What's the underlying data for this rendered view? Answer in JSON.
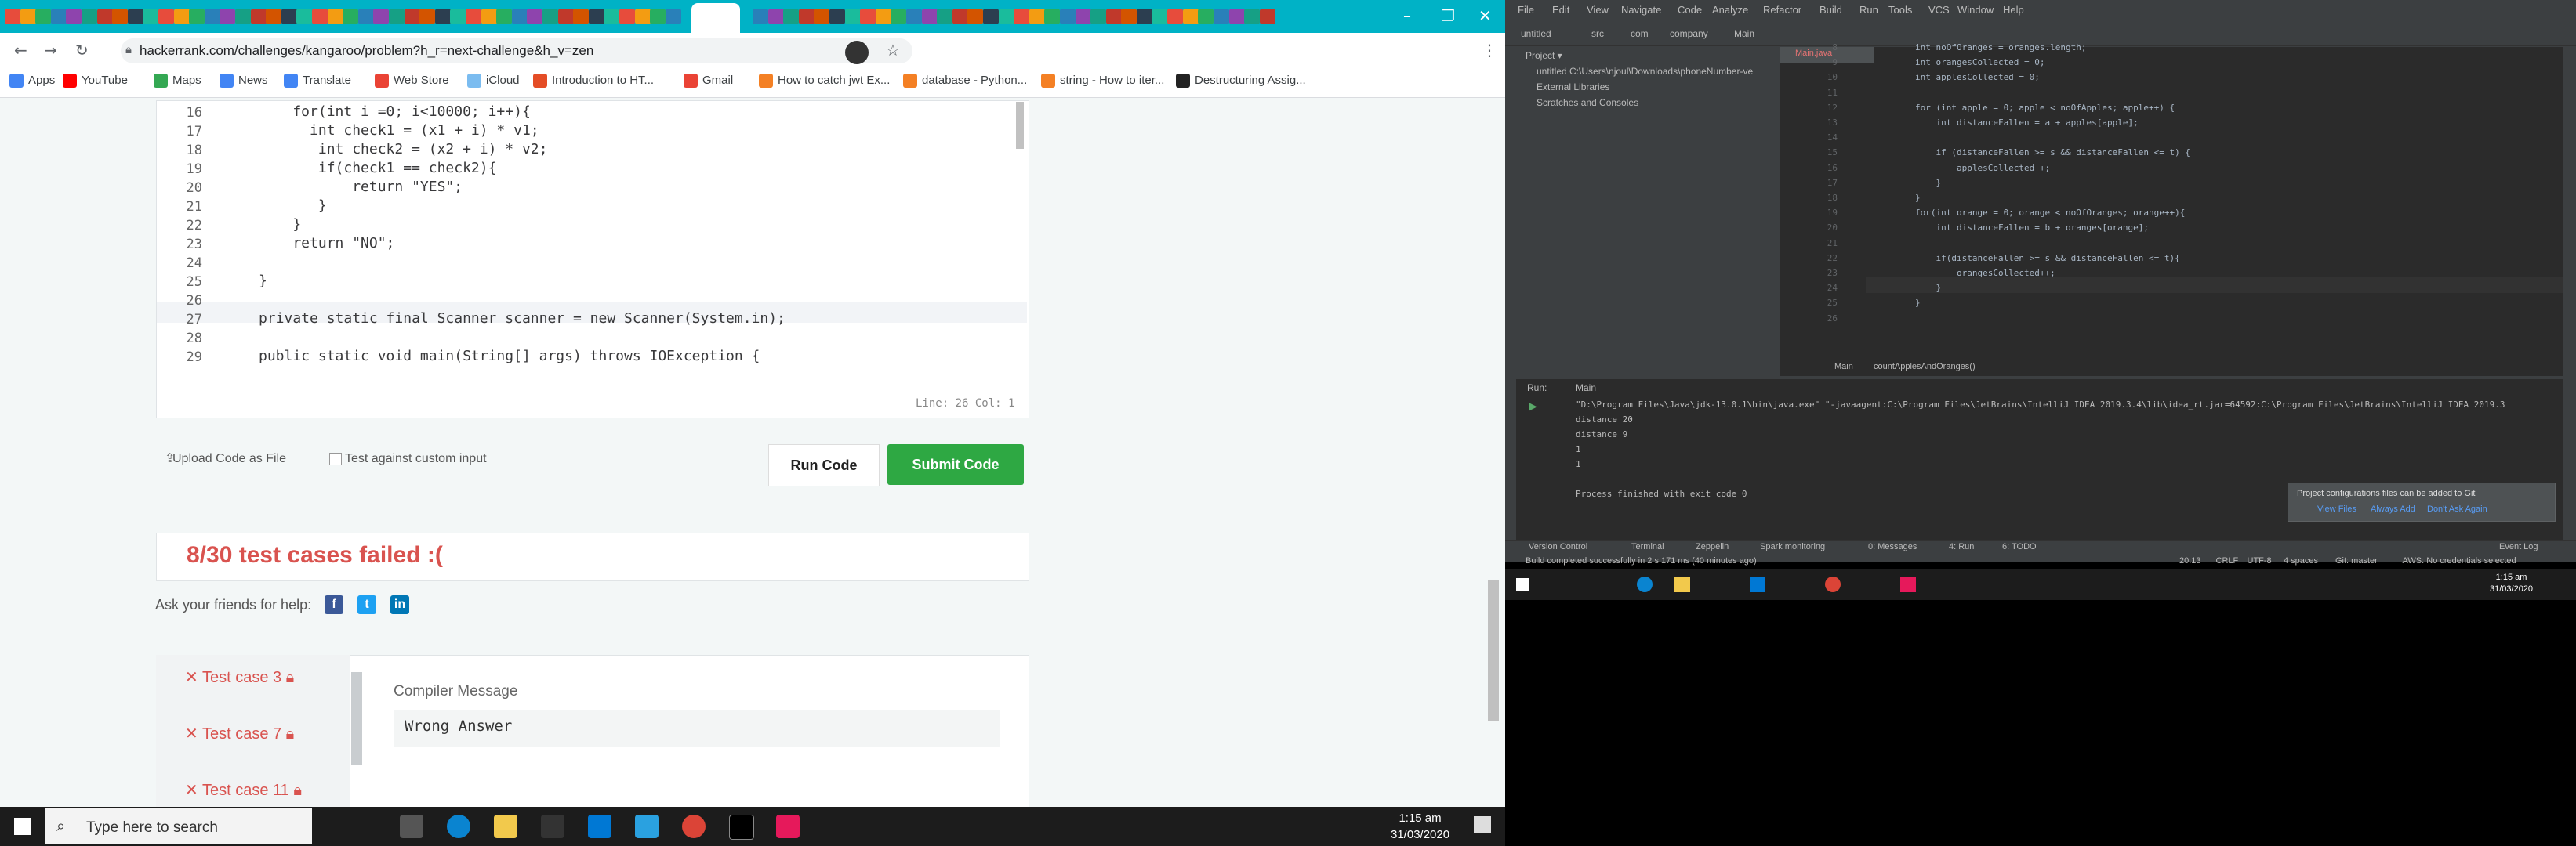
{
  "browser": {
    "url": "hackerrank.com/challenges/kangaroo/problem?h_r=next-challenge&h_v=zen",
    "bookmarks": [
      "Apps",
      "YouTube",
      "Maps",
      "News",
      "Translate",
      "Web Store",
      "iCloud",
      "Introduction to HT...",
      "Gmail",
      "How to catch jwt Ex...",
      "database - Python...",
      "string - How to iter...",
      "Destructuring Assig..."
    ]
  },
  "editor": {
    "line_numbers": [
      "16",
      "17",
      "18",
      "19",
      "20",
      "21",
      "22",
      "23",
      "24",
      "25",
      "26",
      "27",
      "28",
      "29"
    ],
    "lines": [
      "    for(int i =0; i<10000; i++){",
      "      int check1 = (x1 + i) * v1;",
      "       int check2 = (x2 + i) * v2;",
      "       if(check1 == check2){",
      "           return \"YES\";",
      "       }",
      "    }",
      "    return \"NO\";",
      "",
      "}",
      "",
      "private static final Scanner scanner = new Scanner(System.in);",
      "",
      "public static void main(String[] args) throws IOException {"
    ],
    "status": "Line: 26 Col: 1"
  },
  "actions": {
    "upload": "Upload Code as File",
    "custom_input": "Test against custom input",
    "run": "Run Code",
    "submit": "Submit Code"
  },
  "result": "8/30 test cases failed :(",
  "ask_friends": "Ask your friends for help:",
  "test_cases": [
    "Test case 3",
    "Test case 7",
    "Test case 11"
  ],
  "compiler": {
    "label": "Compiler Message",
    "value": "Wrong Answer"
  },
  "taskbar": {
    "search": "Type here to search",
    "time": "1:15 am",
    "date": "31/03/2020"
  },
  "ide": {
    "menu": [
      "File",
      "Edit",
      "View",
      "Navigate",
      "Code",
      "Analyze",
      "Refactor",
      "Build",
      "Run",
      "Tools",
      "VCS",
      "Window",
      "Help"
    ],
    "breadcrumbs": [
      "untitled",
      "src",
      "com",
      "company",
      "Main"
    ],
    "tab": "Main.java",
    "project_items": [
      "untitled C:\\Users\\njoul\\Downloads\\phoneNumber-ve",
      "External Libraries",
      "Scratches and Consoles"
    ],
    "line_numbers": [
      "",
      "",
      "",
      "",
      "",
      "",
      "",
      "",
      "",
      "",
      "",
      "",
      "",
      "",
      "",
      "",
      "",
      "",
      ""
    ],
    "code": [
      "        int noOfOranges = oranges.length;",
      "        int orangesCollected = 0;",
      "        int applesCollected = 0;",
      "",
      "        for (int apple = 0; apple < noOfApples; apple++) {",
      "            int distanceFallen = a + apples[apple];",
      "",
      "            if (distanceFallen >= s && distanceFallen <= t) {",
      "                applesCollected++;",
      "            }",
      "        }",
      "        for(int orange = 0; orange < noOfOranges; orange++){",
      "            int distanceFallen = b + oranges[orange];",
      "",
      "            if(distanceFallen >= s && distanceFallen <= t){",
      "                orangesCollected++;",
      "            }",
      "        }",
      ""
    ],
    "code_footer": [
      "Main",
      "countApplesAndOranges()"
    ],
    "run_tab": "Main",
    "console": [
      "\"D:\\Program Files\\Java\\jdk-13.0.1\\bin\\java.exe\" \"-javaagent:C:\\Program Files\\JetBrains\\IntelliJ IDEA 2019.3.4\\lib\\idea_rt.jar=64592:C:\\Program Files\\JetBrains\\IntelliJ IDEA 2019.3",
      "distance 20",
      "distance 9",
      "1",
      "1",
      "",
      "Process finished with exit code 0"
    ],
    "notification": {
      "text": "Project configurations files can be added to Git",
      "links": [
        "View Files",
        "Always Add",
        "Don't Ask Again"
      ]
    },
    "bottom_tabs": [
      "Version Control",
      "Terminal",
      "Zeppelin",
      "Spark monitoring",
      "0: Messages",
      "4: Run",
      "6: TODO"
    ],
    "event_log": "Event Log",
    "build_status": "Build completed successfully in 2 s 171 ms (40 minutes ago)",
    "status_right": [
      "20:13",
      "CRLF",
      "UTF-8",
      "4 spaces",
      "Git: master",
      "AWS: No credentials selected"
    ],
    "time": "1:15 am",
    "date": "31/03/2020"
  }
}
